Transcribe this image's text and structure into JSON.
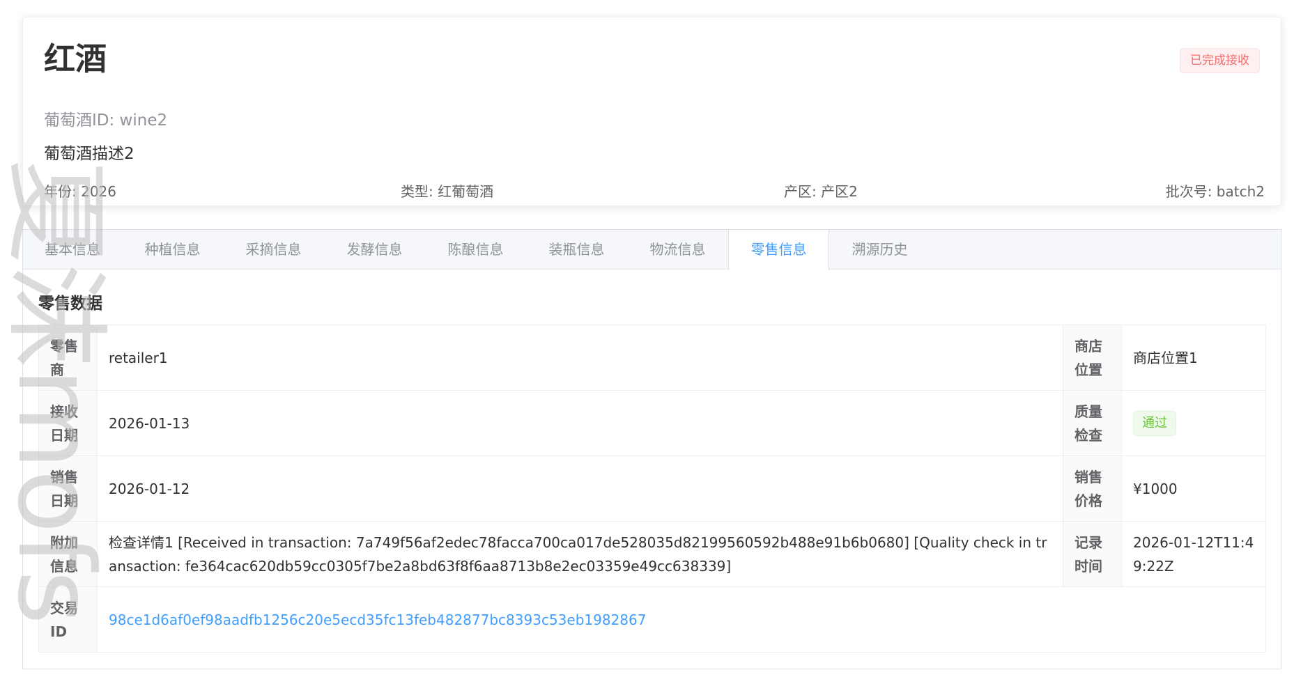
{
  "header": {
    "title": "红酒",
    "wine_id": "葡萄酒ID: wine2",
    "description": "葡萄酒描述2",
    "year": "年份: 2026",
    "type": "类型: 红葡萄酒",
    "region": "产区: 产区2",
    "batch": "批次号: batch2",
    "status": "已完成接收"
  },
  "tabs": [
    {
      "label": "基本信息",
      "active": false
    },
    {
      "label": "种植信息",
      "active": false
    },
    {
      "label": "采摘信息",
      "active": false
    },
    {
      "label": "发酵信息",
      "active": false
    },
    {
      "label": "陈酿信息",
      "active": false
    },
    {
      "label": "装瓶信息",
      "active": false
    },
    {
      "label": "物流信息",
      "active": false
    },
    {
      "label": "零售信息",
      "active": true
    },
    {
      "label": "溯源历史",
      "active": false
    }
  ],
  "retail": {
    "section_title": "零售数据",
    "rows": [
      {
        "label": "零售商",
        "value": "retailer1",
        "label2": "商店位置",
        "value2": "商店位置1"
      },
      {
        "label": "接收日期",
        "value": "2026-01-13",
        "label2": "质量检查",
        "value2": "通过"
      },
      {
        "label": "销售日期",
        "value": "2026-01-12",
        "label2": "销售价格",
        "value2": "¥1000"
      },
      {
        "label": "附加信息",
        "value": "检查详情1 [Received in transaction: 7a749f56af2edec78facca700ca017de528035d82199560592b488e91b6b0680] [Quality check in transaction: fe364cac620db59cc0305f7be2a8bd63f8f6aa8713b8e2ec03359e49cc638339]",
        "label2": "记录时间",
        "value2": "2026-01-12T11:49:22Z"
      },
      {
        "label": "交易ID",
        "value": "98ce1d6af0ef98aadfb1256c20e5ecd35fc13feb482877bc8393c53eb1982867"
      }
    ]
  },
  "watermark": "夏沫mofs",
  "colors": {
    "accent": "#409eff",
    "danger": "#f56c6c",
    "success": "#67c23a"
  }
}
